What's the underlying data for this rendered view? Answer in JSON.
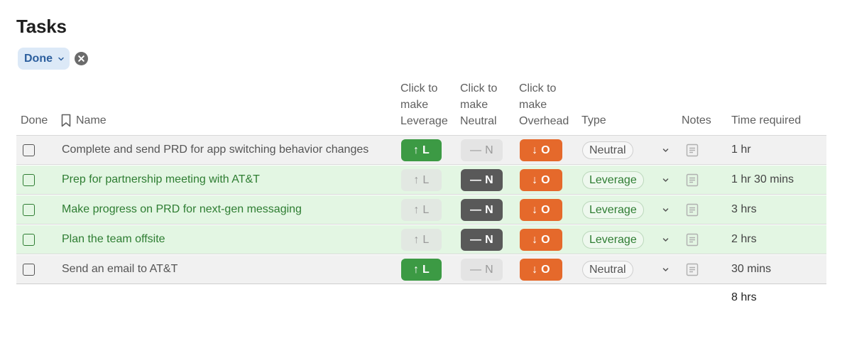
{
  "page": {
    "title": "Tasks"
  },
  "filter": {
    "label": "Done"
  },
  "columns": {
    "done": "Done",
    "name": "Name",
    "leverage": [
      "Click to",
      "make",
      "Leverage"
    ],
    "neutral": [
      "Click to",
      "make",
      "Neutral"
    ],
    "overhead": [
      "Click to",
      "make",
      "Overhead"
    ],
    "type": "Type",
    "notes": "Notes",
    "time": "Time required"
  },
  "buttons": {
    "leverage": "↑ L",
    "neutral": "— N",
    "overhead": "↓ O"
  },
  "rows": [
    {
      "name": "Complete and send PRD for app switching behavior changes",
      "type": "Neutral",
      "time": "1 hr"
    },
    {
      "name": "Prep for partnership meeting with AT&T",
      "type": "Leverage",
      "time": "1 hr 30 mins"
    },
    {
      "name": "Make progress on PRD for next-gen messaging",
      "type": "Leverage",
      "time": "3 hrs"
    },
    {
      "name": "Plan the team offsite",
      "type": "Leverage",
      "time": "2 hrs"
    },
    {
      "name": "Send an email to AT&T",
      "type": "Neutral",
      "time": "30 mins"
    }
  ],
  "total": "8 hrs",
  "colors": {
    "leverage": "#3c9a44",
    "neutral": "#595959",
    "overhead": "#e5692b",
    "leverage_row": "#e3f6e3",
    "neutral_row": "#f1f1f1",
    "filter_chip": "#dce9f7"
  },
  "icons": {
    "filter_chevron": "chevron-down-icon",
    "clear": "close-circle-icon",
    "name_header": "bookmark-icon",
    "type_dropdown": "chevron-down-icon",
    "notes": "document-icon"
  }
}
